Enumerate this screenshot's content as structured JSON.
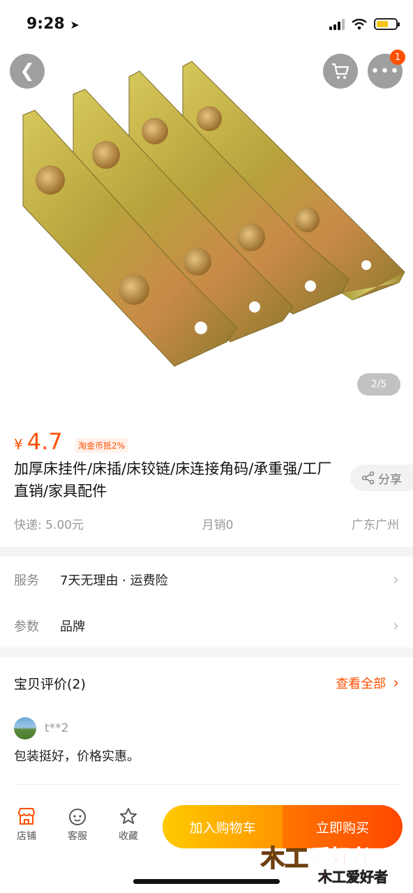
{
  "status_bar": {
    "time": "9:28",
    "battery_color": "#f5c518"
  },
  "hero": {
    "image_counter": "2/5",
    "more_badge": "1"
  },
  "product": {
    "currency": "¥",
    "price": "4.7",
    "coin_tag": "淘金币抵2%",
    "title": "加厚床挂件/床插/床铰链/床连接角码/承重强/工厂直销/家具配件",
    "share_label": "分享",
    "shipping": "快递: 5.00元",
    "monthly_sales": "月销0",
    "location": "广东广州"
  },
  "service": {
    "service_key": "服务",
    "service_value": "7天无理由 · 运费险",
    "params_key": "参数",
    "params_value": "品牌"
  },
  "reviews": {
    "heading": "宝贝评价(2)",
    "see_all": "查看全部",
    "reviewer": "t**2",
    "text": "包装挺好，价格实惠。"
  },
  "bottom_bar": {
    "store": "店铺",
    "customer_service": "客服",
    "favorite": "收藏",
    "add_to_cart": "加入购物车",
    "buy_now": "立即购买",
    "watermark_text": "木工爱好者"
  },
  "colors": {
    "accent": "#ff5000",
    "cart_btn": "#ffb000",
    "buy_btn": "#ff5a00"
  }
}
